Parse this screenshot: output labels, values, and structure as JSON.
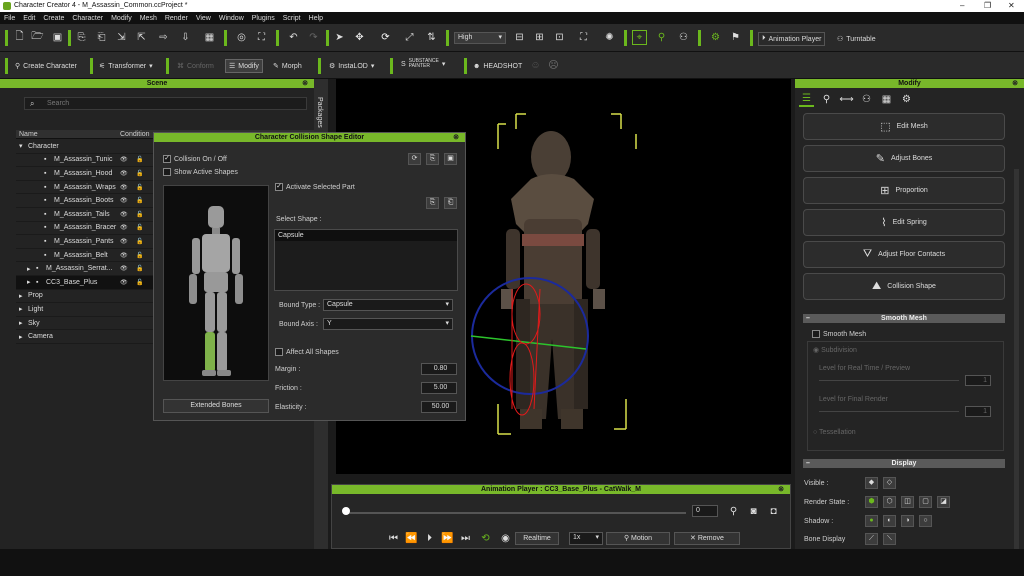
{
  "window": {
    "title": "Character Creator 4 - M_Assassin_Common.ccProject *",
    "min": "–",
    "max": "❐",
    "close": "✕"
  },
  "menu": [
    "File",
    "Edit",
    "Create",
    "Character",
    "Modify",
    "Mesh",
    "Render",
    "View",
    "Window",
    "Plugins",
    "Script",
    "Help"
  ],
  "toolbar1": {
    "quality": "High",
    "anim_player": "Animation Player",
    "turntable": "Turntable"
  },
  "toolbar2": {
    "create_character": "Create Character",
    "transformer": "Transformer",
    "conform": "Conform",
    "modify": "Modify",
    "morph": "Morph",
    "instalod": "InstaLOD",
    "substance_a": "SUBSTANCE",
    "substance_b": "PAINTER",
    "headshot": "HEADSHOT"
  },
  "scene": {
    "title": "Scene",
    "search_placeholder": "Search",
    "col_name": "Name",
    "col_condition": "Condition",
    "side_tab": "Packages",
    "rows": [
      {
        "label": "Character",
        "indent": 0,
        "arrow": "▾"
      },
      {
        "label": "M_Assassin_Tunic",
        "indent": 2
      },
      {
        "label": "M_Assassin_Hood",
        "indent": 2
      },
      {
        "label": "M_Assassin_Wraps",
        "indent": 2
      },
      {
        "label": "M_Assassin_Boots",
        "indent": 2
      },
      {
        "label": "M_Assassin_Tails",
        "indent": 2
      },
      {
        "label": "M_Assassin_Bracer",
        "indent": 2
      },
      {
        "label": "M_Assassin_Pants",
        "indent": 2
      },
      {
        "label": "M_Assassin_Belt",
        "indent": 2
      },
      {
        "label": "M_Assassin_Serrat...",
        "indent": 1,
        "arrow": "▸"
      },
      {
        "label": "CC3_Base_Plus",
        "indent": 1,
        "arrow": "▸",
        "selected": true
      },
      {
        "label": "Prop",
        "indent": 0,
        "arrow": "▸"
      },
      {
        "label": "Light",
        "indent": 0,
        "arrow": "▸"
      },
      {
        "label": "Sky",
        "indent": 0,
        "arrow": "▸"
      },
      {
        "label": "Camera",
        "indent": 0,
        "arrow": "▸"
      }
    ]
  },
  "ccse": {
    "title": "Character Collision Shape Editor",
    "collision_onoff": "Collision On / Off",
    "show_active": "Show Active Shapes",
    "activate_part": "Activate Selected Part",
    "select_shape": "Select Shape :",
    "shape_value": "Capsule",
    "bound_type_label": "Bound Type :",
    "bound_type": "Capsule",
    "bound_axis_label": "Bound Axis :",
    "bound_axis": "Y",
    "affect_all": "Affect All Shapes",
    "margin_label": "Margin :",
    "margin": "0.80",
    "friction_label": "Friction :",
    "friction": "5.00",
    "elasticity_label": "Elasticity :",
    "elasticity": "50.00",
    "extended_bones": "Extended Bones"
  },
  "anim": {
    "title": "Animation Player : CC3_Base_Plus - CatWalk_M",
    "frame": "0",
    "progress": 0.0,
    "realtime": "Realtime",
    "speed": "1x",
    "motion": "Motion",
    "remove": "Remove"
  },
  "modify": {
    "title": "Modify",
    "buttons": [
      "Edit Mesh",
      "Adjust Bones",
      "Proportion",
      "Edit Spring",
      "Adjust Floor Contacts",
      "Collision Shape"
    ],
    "smooth_title": "Smooth Mesh",
    "smooth_mesh": "Smooth Mesh",
    "subdivision": "Subdivision",
    "lvl_realtime": "Level for Real Time / Preview",
    "lvl_realtime_val": "1",
    "lvl_final": "Level for Final Render",
    "lvl_final_val": "1",
    "tessellation": "Tessellation",
    "display_title": "Display",
    "visible": "Visible :",
    "render_state": "Render State :",
    "shadow": "Shadow :",
    "bone_display": "Bone Display"
  }
}
